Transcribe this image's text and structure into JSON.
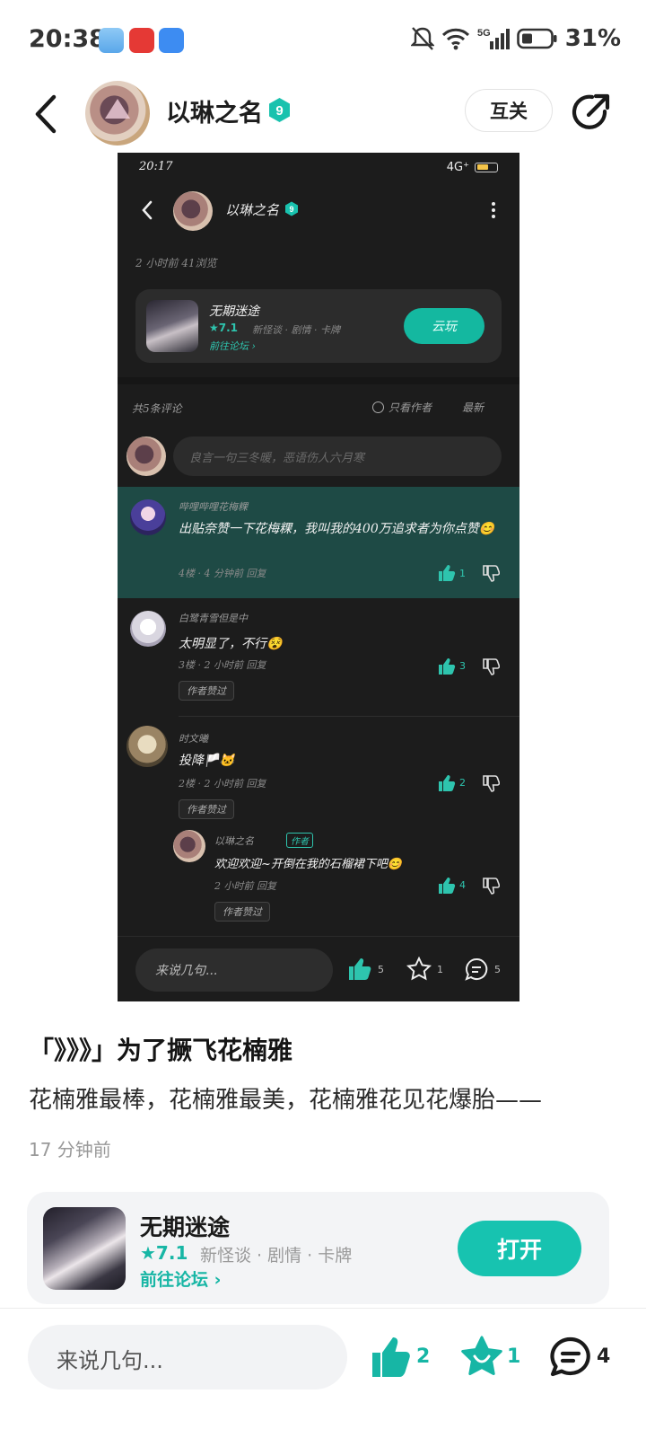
{
  "status_bar": {
    "time": "20:38",
    "battery": "31%",
    "network": "5G"
  },
  "header": {
    "username": "以琳之名",
    "level": "9",
    "follow_label": "互关"
  },
  "embedded_screenshot": {
    "status_time": "20:17",
    "network": "4G⁺",
    "author": "以琳之名",
    "level": "9",
    "meta": "2 小时前  41浏览",
    "game": {
      "name": "无期迷途",
      "rating": "★7.1",
      "tags": "新怪谈 · 剧情 · 卡牌",
      "forum": "前往论坛 ›",
      "button": "云玩"
    },
    "comment_count": "共5条评论",
    "filter_label": "只看作者",
    "sort_label": "最新",
    "input_placeholder": "良言一句三冬暖，恶语伤人六月寒",
    "comments": [
      {
        "name": "哔哩哔哩花梅粿",
        "text": "出贴奈赞一下花梅粿，我叫我的400万追求者为你点赞😊",
        "meta": "4楼 · 4 分钟前  回复",
        "likes": "1"
      },
      {
        "name": "白鹭青雪但是中",
        "text": "太明显了，不行😵",
        "meta": "3楼 · 2 小时前  回复",
        "likes": "3",
        "tag": "作者赞过"
      },
      {
        "name": "时文曦",
        "text": "投降🏳️🐱",
        "meta": "2楼 · 2 小时前  回复",
        "likes": "2",
        "tag": "作者赞过"
      },
      {
        "name": "以琳之名",
        "badge": "作者",
        "text": "欢迎欢迎~开倒在我的石榴裙下吧😊",
        "meta": "2 小时前  回复",
        "likes": "4",
        "tag": "作者赞过"
      }
    ],
    "bottom": {
      "placeholder": "来说几句...",
      "likes": "5",
      "favs": "1",
      "comments": "5"
    }
  },
  "post": {
    "title": "「》》》」为了撅飞花楠雅",
    "body": "花楠雅最棒，花楠雅最美，花楠雅花见花爆胎——",
    "time": "17 分钟前"
  },
  "game_card": {
    "name": "无期迷途",
    "rating": "★7.1",
    "tags": "新怪谈 · 剧情 · 卡牌",
    "forum": "前往论坛 ›",
    "button": "打开"
  },
  "bottom_bar": {
    "placeholder": "来说几句...",
    "likes": "2",
    "favs": "1",
    "comments": "4"
  },
  "colors": {
    "accent": "#17c3b0",
    "dark_bg": "#1c1c1c",
    "highlight": "#1e4a45"
  }
}
